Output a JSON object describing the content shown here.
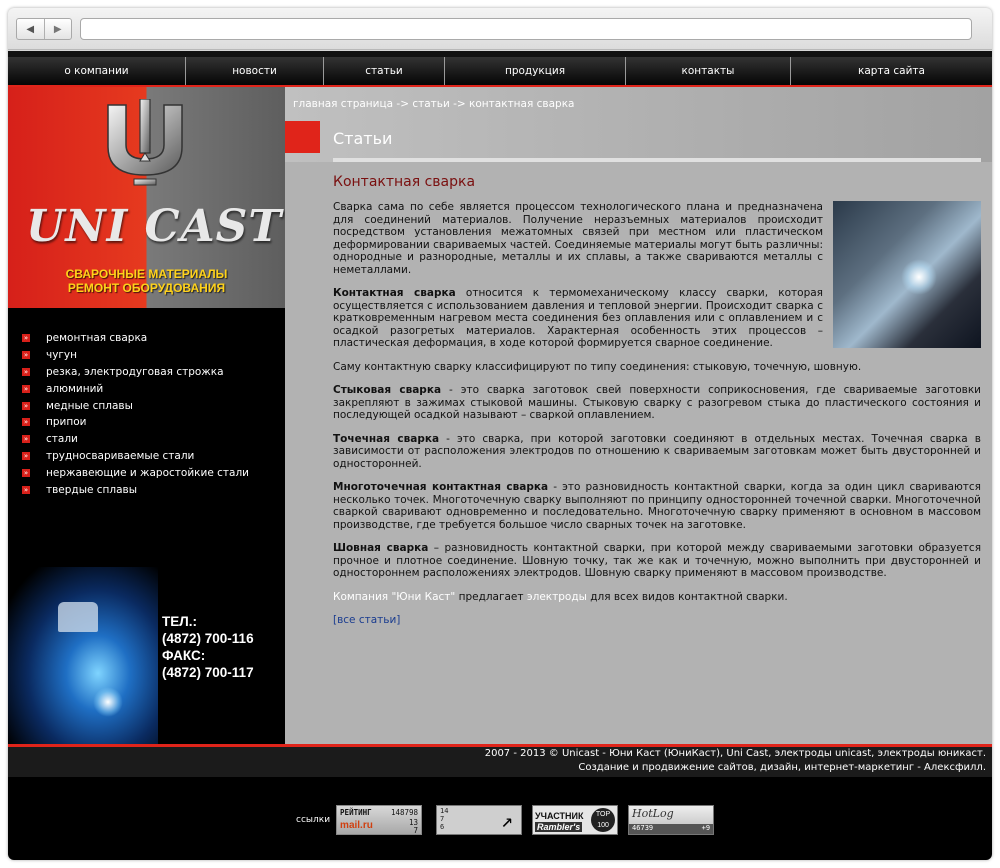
{
  "topnav": [
    "о компании",
    "новости",
    "статьи",
    "продукция",
    "контакты",
    "карта сайта"
  ],
  "logo": {
    "brand": "UNI CAST",
    "tagline1": "СВАРОЧНЫЕ МАТЕРИАЛЫ",
    "tagline2": "РЕМОНТ ОБОРУДОВАНИЯ"
  },
  "sidemenu": [
    "ремонтная сварка",
    "чугун",
    "резка, электродуговая строжка",
    "алюминий",
    "медные сплавы",
    "припои",
    "стали",
    "трудносвариваемые стали",
    "нержавеющие и жаростойкие стали",
    "твердые сплавы"
  ],
  "contacts": {
    "tel_label": "ТЕЛ.:",
    "tel": "(4872) 700-116",
    "fax_label": "ФАКС:",
    "fax": "(4872) 700-117"
  },
  "breadcrumb": "главная страница -> статьи -> контактная сварка",
  "section_title": "Статьи",
  "article_title": "Контактная сварка",
  "article": {
    "p1": "Сварка сама по себе является процессом технологического плана и предназначена для соединений материалов. Получение неразъемных материалов происходит посредством установления межатомных связей при местном или пластическом деформировании свариваемых частей. Соединяемые материалы могут быть различны: однородные и разнородные, металлы и их сплавы, а также свариваются металлы с неметаллами.",
    "p2_bold": "Контактная сварка",
    "p2": " относится к термомеханическому классу сварки, которая осуществляется с использованием давления и тепловой энергии. Происходит сварка с кратковременным нагревом места соединения без оплавления или с оплавлением и с осадкой разогретых материалов. Характерная особенность этих процессов – пластическая деформация, в ходе которой формируется сварное соединение.",
    "p3": "Саму контактную сварку классифицируют по типу соединения: стыковую, точечную, шовную.",
    "p4_bold": "Стыковая сварка",
    "p4": " - это сварка заготовок свей поверхности соприкосновения, где свариваемые заготовки закрепляют в зажимах стыковой машины. Стыковую сварку с разогревом стыка до пластического состояния и последующей осадкой называют – сваркой оплавлением.",
    "p5_bold": "Точечная сварка",
    "p5": " - это сварка, при которой заготовки соединяют в отдельных местах. Точечная сварка в зависимости от расположения электродов по отношению к свариваемым заготовкам может быть двусторонней и односторонней.",
    "p6_bold": "Многоточечная контактная сварка",
    "p6": " - это разновидность контактной сварки, когда за один цикл свариваются несколько точек. Многоточечную сварку выполняют по принципу односторонней точечной сварки. Многоточечной сваркой сваривают одновременно и последовательно. Многоточечную сварку применяют в основном в массовом производстве, где требуется большое число сварных точек на заготовке.",
    "p7_bold": "Шовная сварка",
    "p7": " – разновидность контактной сварки, при которой между свариваемыми заготовки образуется прочное и плотное соединение. Шовную точку, так же как и точечную, можно выполнить при двусторонней и одностороннем расположениях электродов. Шовную сварку применяют в массовом производстве.",
    "p8_link1": "Компания \"Юни Каст\"",
    "p8_mid": " предлагает ",
    "p8_link2": "электроды",
    "p8_end": " для всех видов контактной сварки.",
    "all_link": "[все статьи]"
  },
  "footer": {
    "line1": "2007 - 2013 © Unicast - Юни Каст (ЮниКаст), Uni Cast, электроды unicast, электроды юникаст.",
    "line2": "Создание и продвижение сайтов, дизайн, интернет-маркетинг - Алексфилл.",
    "links_label": "ссылки"
  },
  "counters": {
    "mail": {
      "label": "РЕЙТИНГ",
      "total": "148798",
      "brand": "mail.ru",
      "n1": "13",
      "n2": "7"
    },
    "li": {
      "v1": "14",
      "v2": "7",
      "v3": "6"
    },
    "rambler": {
      "line1": "УЧАСТНИК",
      "line2": "Rambler's",
      "badge": "TOP 100"
    },
    "hotlog": {
      "brand": "HotLog",
      "n1": "46739",
      "n2": "+9"
    }
  },
  "colors": {
    "accent_red": "#e0241a",
    "tagline_yellow": "#ffd21a",
    "title_dark_red": "#7a1010",
    "content_gray": "#b2b2b2"
  }
}
